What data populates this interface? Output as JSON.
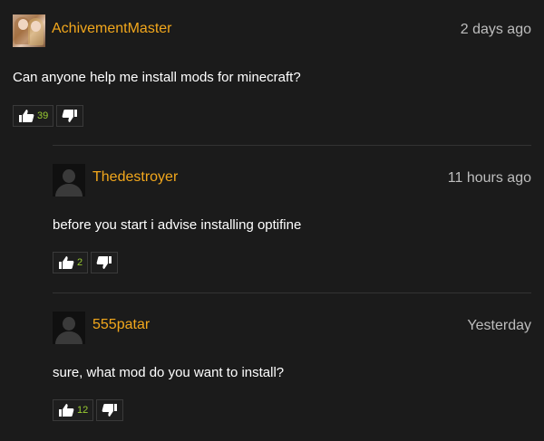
{
  "comments": [
    {
      "username": "AchivementMaster",
      "time": "2 days ago",
      "text": "Can anyone help me install mods for minecraft?",
      "upvotes": "39"
    },
    {
      "username": "Thedestroyer",
      "time": "11 hours ago",
      "text": "before you start i advise installing optifine",
      "upvotes": "2"
    },
    {
      "username": "555patar",
      "time": "Yesterday",
      "text": "sure, what mod do you want to install?",
      "upvotes": "12"
    }
  ],
  "colors": {
    "username": "#f2a71c",
    "vote_count": "#9acd32",
    "background": "#1b1b1b"
  },
  "icons": {
    "upvote": "thumbs-up-icon",
    "downvote": "thumbs-down-icon"
  }
}
